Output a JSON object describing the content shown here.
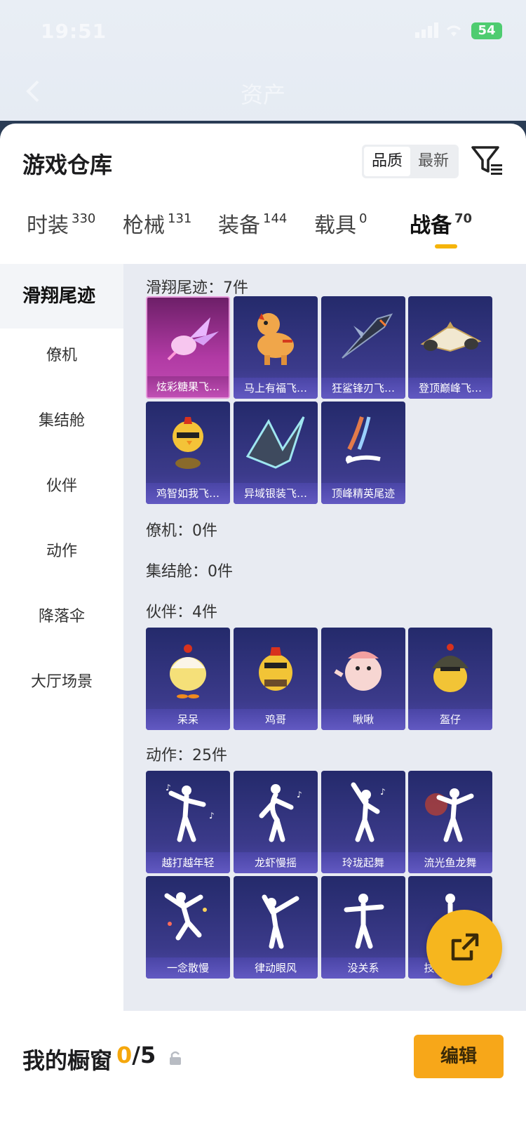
{
  "status": {
    "time": "19:51",
    "battery": "54"
  },
  "nav": {
    "title": "资产"
  },
  "panel": {
    "title": "游戏仓库"
  },
  "sort": {
    "options": [
      "品质",
      "最新"
    ],
    "active": "品质"
  },
  "tabs": [
    {
      "label": "时装",
      "count": "330"
    },
    {
      "label": "枪械",
      "count": "131"
    },
    {
      "label": "装备",
      "count": "144"
    },
    {
      "label": "载具",
      "count": "0"
    },
    {
      "label": "战备",
      "count": "70",
      "active": true
    }
  ],
  "sidebar": {
    "items": [
      "滑翔尾迹",
      "僚机",
      "集结舱",
      "伙伴",
      "动作",
      "降落伞",
      "大厅场景"
    ],
    "active": "滑翔尾迹"
  },
  "sections": {
    "glide": {
      "header": "滑翔尾迹：7件",
      "items": [
        "炫彩糖果飞…",
        "马上有福飞…",
        "狂鲨锋刃飞…",
        "登顶巅峰飞…",
        "鸡智如我飞…",
        "异域银装飞…",
        "顶峰精英尾迹"
      ]
    },
    "wingman": {
      "header": "僚机：0件"
    },
    "pod": {
      "header": "集结舱：0件"
    },
    "partner": {
      "header": "伙伴：4件",
      "items": [
        "呆呆",
        "鸡哥",
        "啾啾",
        "盔仔"
      ]
    },
    "emote": {
      "header": "动作：25件",
      "items": [
        "越打越年轻",
        "龙虾慢摇",
        "玲珑起舞",
        "流光鱼龙舞",
        "一念散慢",
        "律动眼风",
        "没关系",
        "技能五子棋"
      ]
    }
  },
  "footer": {
    "label": "我的橱窗",
    "count_current": "0",
    "count_total": "/5",
    "edit_label": "编辑"
  },
  "colors": {
    "accent": "#f5b40a",
    "card_bg": "#2c2f78",
    "card_label": "#5a52b8",
    "pink_card": "#b13aa4"
  }
}
